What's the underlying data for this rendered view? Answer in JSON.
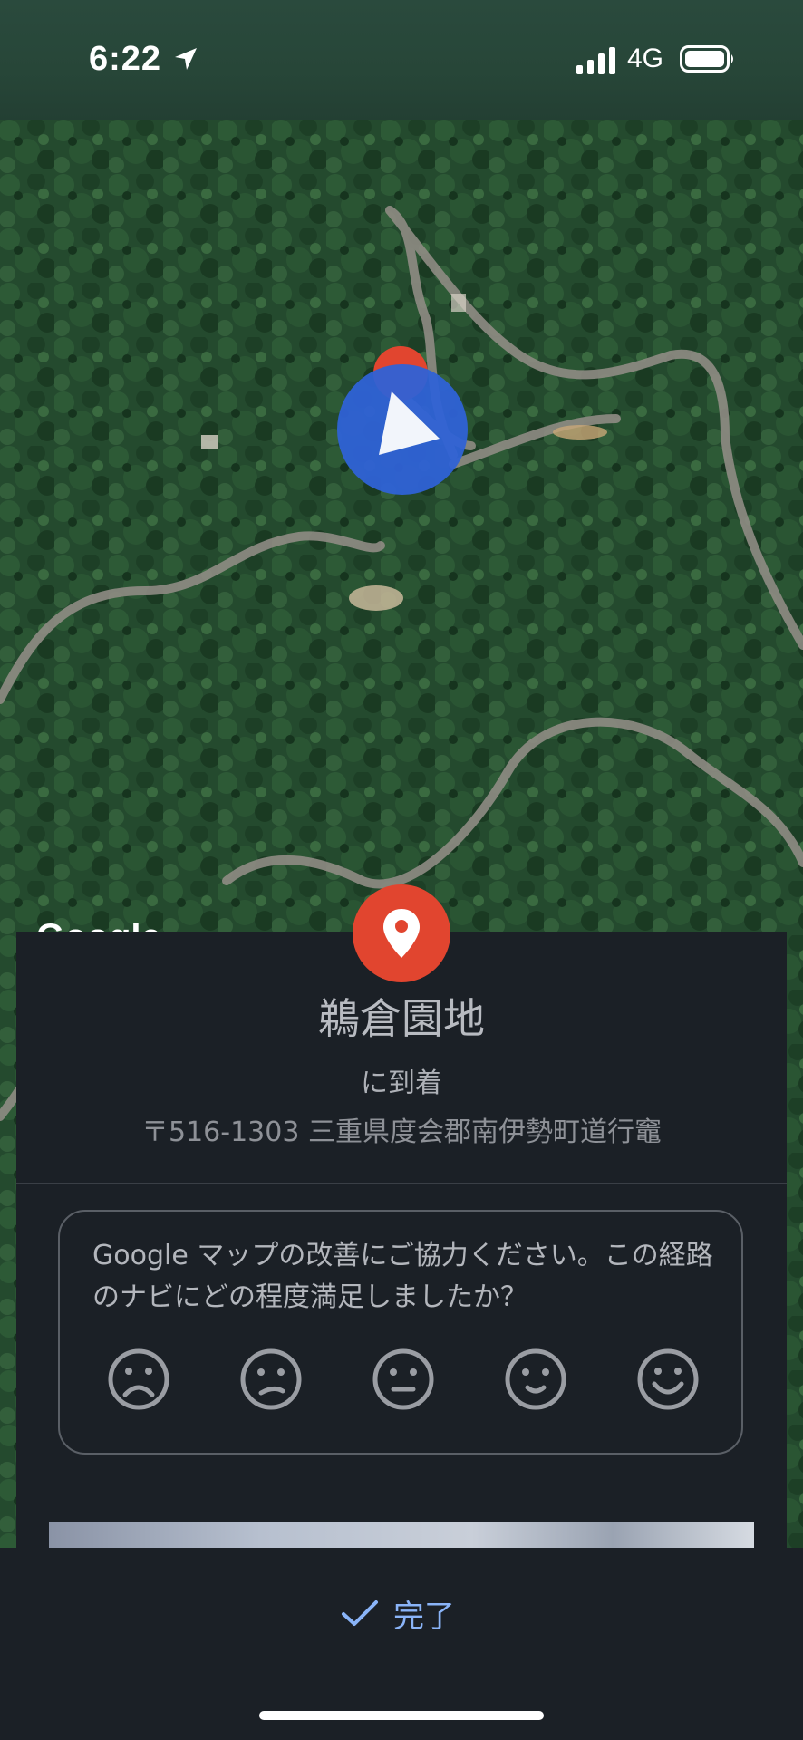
{
  "status_bar": {
    "time": "6:22",
    "network": "4G"
  },
  "map": {
    "watermark": "Google"
  },
  "destination": {
    "name": "鵜倉園地",
    "arrival_text": "に到着",
    "address": "〒516-1303 三重県度会郡南伊勢町道行竈"
  },
  "survey": {
    "question": "Google マップの改善にご協力ください。この経路のナビにどの程度満足しましたか？",
    "ratings": [
      "very-dissatisfied",
      "dissatisfied",
      "neutral",
      "satisfied",
      "very-satisfied"
    ]
  },
  "actions": {
    "done_label": "完了"
  },
  "colors": {
    "accent": "#8ab4f8",
    "pin": "#e1452f",
    "nav_arrow": "#2f62d6",
    "sheet": "#1b2026"
  }
}
